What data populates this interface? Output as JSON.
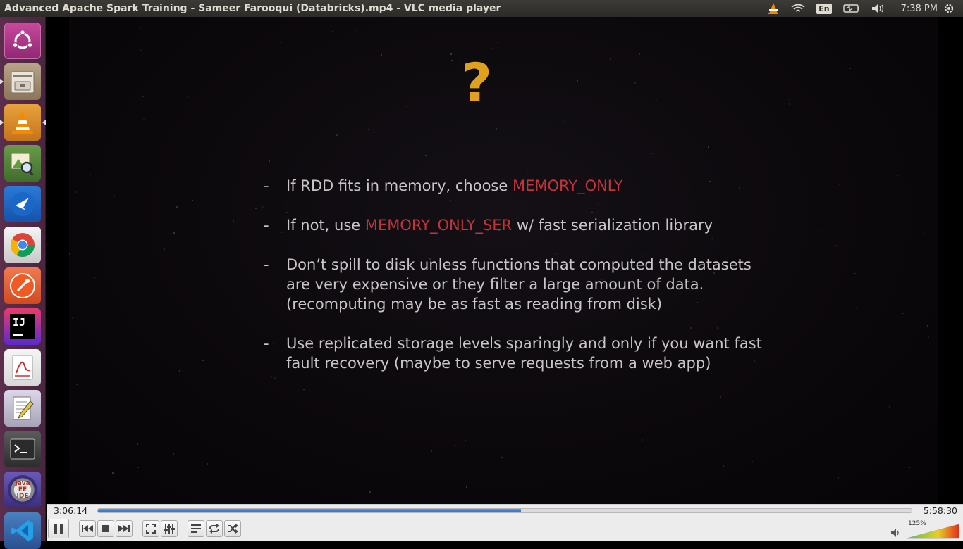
{
  "window": {
    "title": "Advanced Apache Spark Training - Sameer Farooqui (Databricks).mp4 - VLC media player"
  },
  "panel": {
    "lang": "En",
    "clock": "7:38 PM"
  },
  "launcher": {
    "items": [
      "Ubuntu Dash",
      "Files",
      "VLC media player",
      "Image Viewer",
      "Feishu",
      "Google Chrome",
      "Postman",
      "IntelliJ IDEA",
      "Document Viewer",
      "Text Editor",
      "Terminal",
      "Eclipse Java EE IDE",
      "Visual Studio Code"
    ],
    "eclipse_label": "Java EE IDE",
    "intellij_label": "IJ"
  },
  "slide": {
    "heading": "?",
    "bullets": [
      {
        "dash": "-",
        "lines": [
          {
            "pre": "If RDD fits in memory, choose ",
            "hl": "MEMORY_ONLY",
            "post": ""
          }
        ]
      },
      {
        "dash": "-",
        "lines": [
          {
            "pre": "If not, use ",
            "hl": "MEMORY_ONLY_SER",
            "post": " w/ fast serialization library"
          }
        ]
      },
      {
        "dash": "-",
        "lines": [
          {
            "pre": "Don’t spill to disk unless functions that computed the datasets",
            "hl": "",
            "post": ""
          },
          {
            "pre": "are very expensive or they filter a large amount of data.",
            "hl": "",
            "post": ""
          },
          {
            "pre": "(recomputing may be as fast as reading from disk)",
            "hl": "",
            "post": ""
          }
        ]
      },
      {
        "dash": "-",
        "lines": [
          {
            "pre": "Use replicated storage levels sparingly and only if you want fast",
            "hl": "",
            "post": ""
          },
          {
            "pre": "fault recovery (maybe to serve requests from a web app)",
            "hl": "",
            "post": ""
          }
        ]
      }
    ]
  },
  "player": {
    "time_elapsed": "3:06:14",
    "time_total": "5:58:30",
    "progress_fraction": 0.52,
    "volume_label": "125%",
    "volume_fraction": 1.0,
    "accent": "#2a6ad0"
  },
  "icons": {
    "play_pause": "pause-icon",
    "prev": "skip-back-icon",
    "stop": "stop-icon",
    "next": "skip-forward-icon",
    "fullscreen": "fullscreen-icon",
    "extended": "equalizer-icon",
    "playlist": "playlist-icon",
    "loop": "loop-icon",
    "shuffle": "shuffle-icon",
    "speaker": "speaker-icon"
  }
}
